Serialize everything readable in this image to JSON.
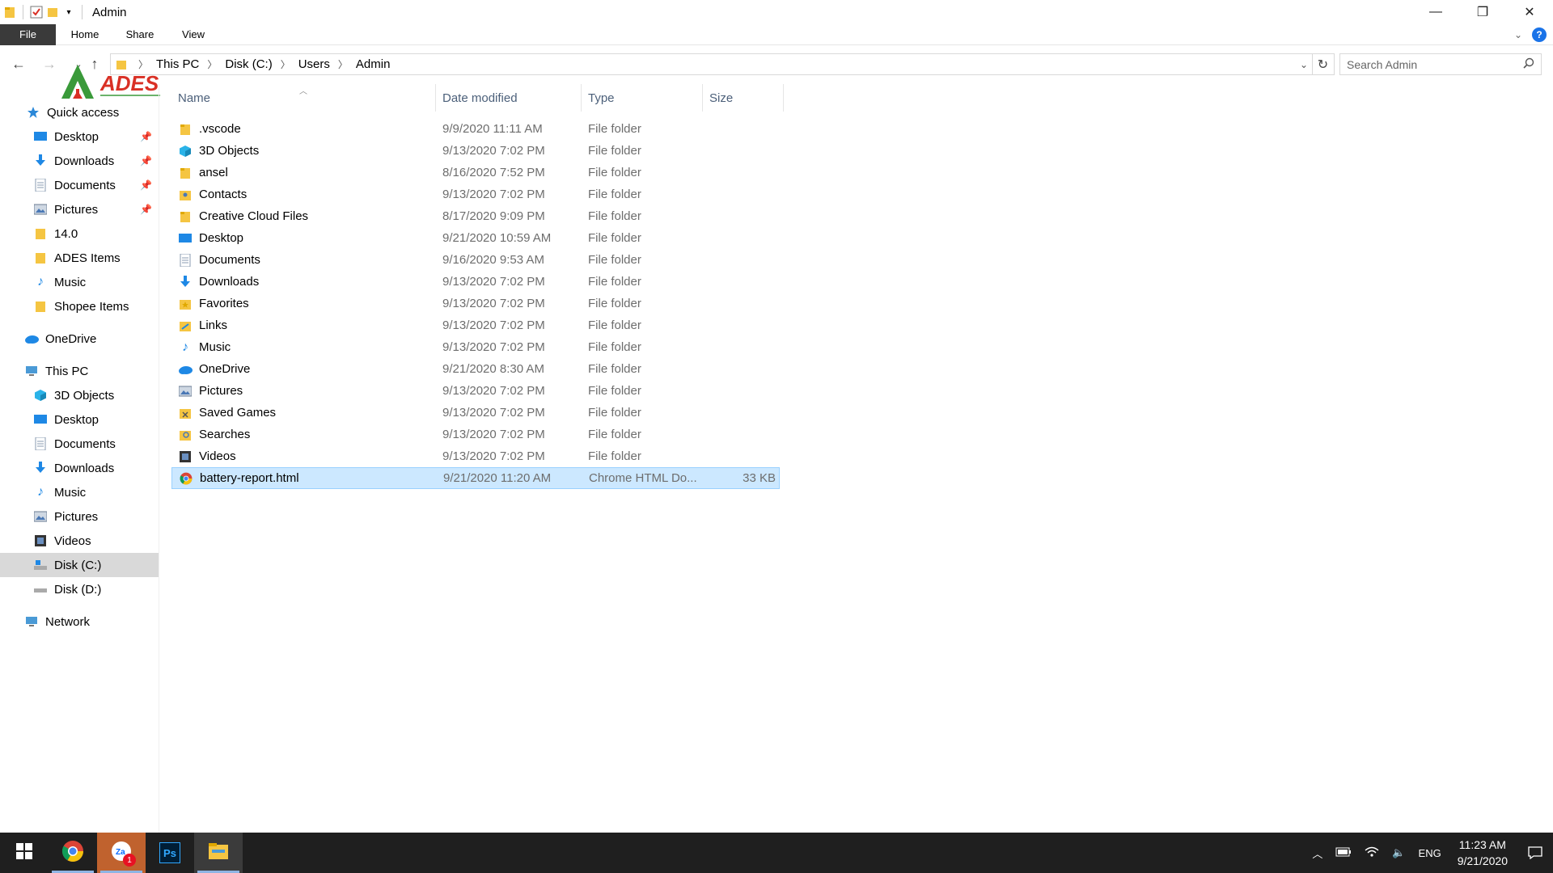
{
  "window": {
    "title": "Admin"
  },
  "ribbon": {
    "tabs": [
      "File",
      "Home",
      "Share",
      "View"
    ]
  },
  "address": {
    "crumbs": [
      "This PC",
      "Disk (C:)",
      "Users",
      "Admin"
    ]
  },
  "search": {
    "placeholder": "Search Admin"
  },
  "logo": {
    "text": "ADES",
    "color": "#d93025"
  },
  "nav": {
    "quick_access": "Quick access",
    "quick_items": [
      "Desktop",
      "Downloads",
      "Documents",
      "Pictures",
      "14.0",
      "ADES Items",
      "Music",
      "Shopee Items"
    ],
    "onedrive": "OneDrive",
    "this_pc": "This PC",
    "pc_items": [
      "3D Objects",
      "Desktop",
      "Documents",
      "Downloads",
      "Music",
      "Pictures",
      "Videos",
      "Disk (C:)",
      "Disk (D:)"
    ],
    "network": "Network"
  },
  "columns": {
    "name": "Name",
    "date": "Date modified",
    "type": "Type",
    "size": "Size"
  },
  "files": [
    {
      "name": ".vscode",
      "date": "9/9/2020 11:11 AM",
      "type": "File folder",
      "size": "",
      "icon": "folder-icon"
    },
    {
      "name": "3D Objects",
      "date": "9/13/2020 7:02 PM",
      "type": "File folder",
      "size": "",
      "icon": "3d-objects-icon"
    },
    {
      "name": "ansel",
      "date": "8/16/2020 7:52 PM",
      "type": "File folder",
      "size": "",
      "icon": "folder-icon"
    },
    {
      "name": "Contacts",
      "date": "9/13/2020 7:02 PM",
      "type": "File folder",
      "size": "",
      "icon": "contacts-icon"
    },
    {
      "name": "Creative Cloud Files",
      "date": "8/17/2020 9:09 PM",
      "type": "File folder",
      "size": "",
      "icon": "folder-icon"
    },
    {
      "name": "Desktop",
      "date": "9/21/2020 10:59 AM",
      "type": "File folder",
      "size": "",
      "icon": "desktop-icon"
    },
    {
      "name": "Documents",
      "date": "9/16/2020 9:53 AM",
      "type": "File folder",
      "size": "",
      "icon": "documents-icon"
    },
    {
      "name": "Downloads",
      "date": "9/13/2020 7:02 PM",
      "type": "File folder",
      "size": "",
      "icon": "downloads-icon"
    },
    {
      "name": "Favorites",
      "date": "9/13/2020 7:02 PM",
      "type": "File folder",
      "size": "",
      "icon": "favorites-icon"
    },
    {
      "name": "Links",
      "date": "9/13/2020 7:02 PM",
      "type": "File folder",
      "size": "",
      "icon": "links-icon"
    },
    {
      "name": "Music",
      "date": "9/13/2020 7:02 PM",
      "type": "File folder",
      "size": "",
      "icon": "music-icon"
    },
    {
      "name": "OneDrive",
      "date": "9/21/2020 8:30 AM",
      "type": "File folder",
      "size": "",
      "icon": "onedrive-icon"
    },
    {
      "name": "Pictures",
      "date": "9/13/2020 7:02 PM",
      "type": "File folder",
      "size": "",
      "icon": "pictures-icon"
    },
    {
      "name": "Saved Games",
      "date": "9/13/2020 7:02 PM",
      "type": "File folder",
      "size": "",
      "icon": "saved-games-icon"
    },
    {
      "name": "Searches",
      "date": "9/13/2020 7:02 PM",
      "type": "File folder",
      "size": "",
      "icon": "searches-icon"
    },
    {
      "name": "Videos",
      "date": "9/13/2020 7:02 PM",
      "type": "File folder",
      "size": "",
      "icon": "videos-icon"
    },
    {
      "name": "battery-report.html",
      "date": "9/21/2020 11:20 AM",
      "type": "Chrome HTML Do...",
      "size": "33 KB",
      "icon": "chrome-icon",
      "selected": true
    }
  ],
  "taskbar": {
    "apps": [
      "start-icon",
      "chrome-icon",
      "zalo-icon",
      "photoshop-icon",
      "file-explorer-icon"
    ],
    "zalo_badge": "1",
    "photoshop_label": "Ps",
    "lang": "ENG",
    "time": "11:23 AM",
    "date": "9/21/2020"
  }
}
